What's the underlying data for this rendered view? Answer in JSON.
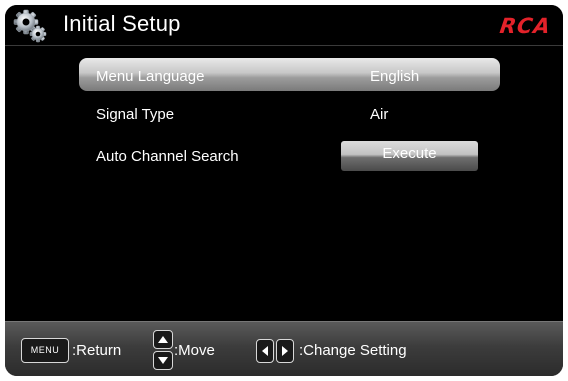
{
  "header": {
    "title": "Initial Setup",
    "brand": "RCA",
    "brand_color": "#e3222a",
    "icon": "gear-icon"
  },
  "menu": {
    "items": [
      {
        "label": "Menu Language",
        "value": "English",
        "selected": true
      },
      {
        "label": "Signal Type",
        "value": "Air",
        "selected": false
      },
      {
        "label": "Auto Channel Search",
        "value": "Execute",
        "selected": false
      }
    ]
  },
  "footer": {
    "menu_key_label": "MENU",
    "return_label": ":Return",
    "move_label": ":Move",
    "change_label": ":Change Setting",
    "icons": [
      "up-arrow-key-icon",
      "down-arrow-key-icon",
      "left-arrow-key-icon",
      "right-arrow-key-icon"
    ]
  }
}
